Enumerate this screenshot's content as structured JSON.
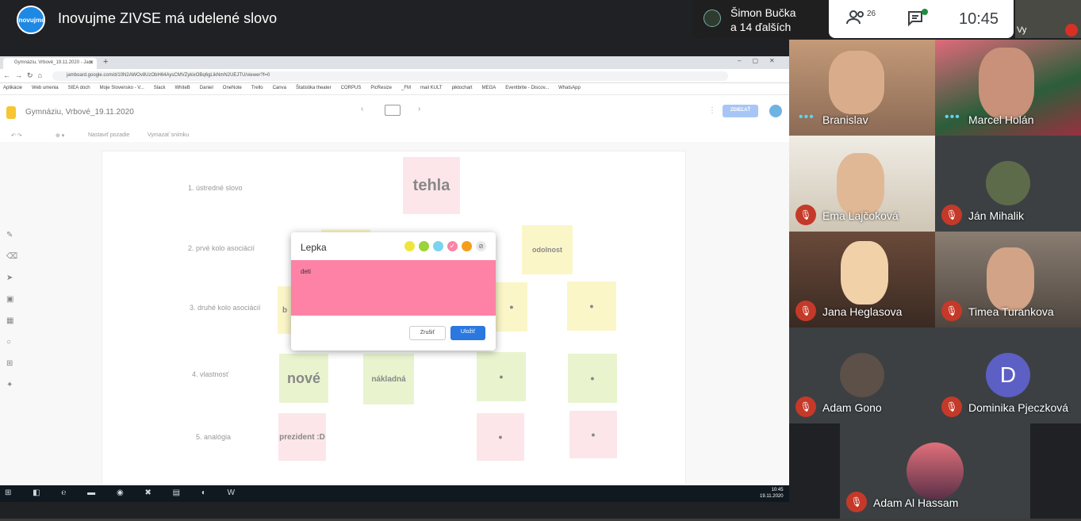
{
  "meet": {
    "logo_text": "inovujme",
    "title": "Inovujme ZIVSE má udelené slovo",
    "presenter_name": "Šimon Bučka",
    "presenter_sub": "a 14 ďalších",
    "people_count": "26",
    "clock": "10:45",
    "self_label": "Vy"
  },
  "browser": {
    "tab_title": "Gymnáziu, Vrbové_19.11.2020 - Jam",
    "url": "jamboard.google.com/d/10N2AWOv8UzObH64AysCMVZykixOBq6gLikNmN2UEJTU/viewer?f=0",
    "bookmarks": [
      "Aplikácie",
      "Web umenia",
      "SIEA doch",
      "Moje Slovensko - V...",
      "Slack",
      "WhiteB",
      "Daniel",
      "OneNote",
      "Trello",
      "Canva",
      "Štatistika theater",
      "CORPUS",
      "PicResize",
      "_FM",
      "mail KULT",
      "piktochart",
      "MEGA",
      "Eventbrite - Discov...",
      "WhatsApp"
    ]
  },
  "jamboard": {
    "doc_name": "Gymnáziu, Vrbové_19.11.2020",
    "share_label": "ZDIEĽAŤ",
    "toolbar": {
      "bg": "Nastaviť pozadie",
      "clear": "Vymazať snímku"
    },
    "rows": [
      "1. ústredné slovo",
      "2. prvé kolo asociácií",
      "3. druhé kolo asociácií",
      "4. vlastnosť",
      "5. analógia"
    ],
    "notes": {
      "tehla": "tehla",
      "odolnost": "odolnost",
      "nove": "nové",
      "nakladna": "nákladná",
      "prezident": "prezident :D",
      "partial_b": "b",
      "dot": "•"
    }
  },
  "dialog": {
    "title": "Lepka",
    "text": "deti",
    "cancel": "Zrušiť",
    "save": "Uložiť",
    "swatch_colors": [
      "#f0e53c",
      "#9ad33a",
      "#7bd4ee",
      "#fd82a6",
      "#f59d1c"
    ]
  },
  "taskbar": {
    "time": "10:45",
    "date": "19.11.2020"
  },
  "participants": [
    {
      "name": "Branislav",
      "state": "speaking"
    },
    {
      "name": "Marcel Holán",
      "state": "speaking"
    },
    {
      "name": "Ema Lajčoková",
      "state": "muted"
    },
    {
      "name": "Ján Mihalik",
      "state": "muted"
    },
    {
      "name": "Jana Heglasova",
      "state": "muted"
    },
    {
      "name": "Timea Turankova",
      "state": "muted"
    },
    {
      "name": "Adam Gono",
      "state": "muted"
    },
    {
      "name": "Dominika Pjeczková",
      "state": "muted",
      "initial": "D"
    },
    {
      "name": "Adam Al Hassam",
      "state": "muted"
    }
  ]
}
